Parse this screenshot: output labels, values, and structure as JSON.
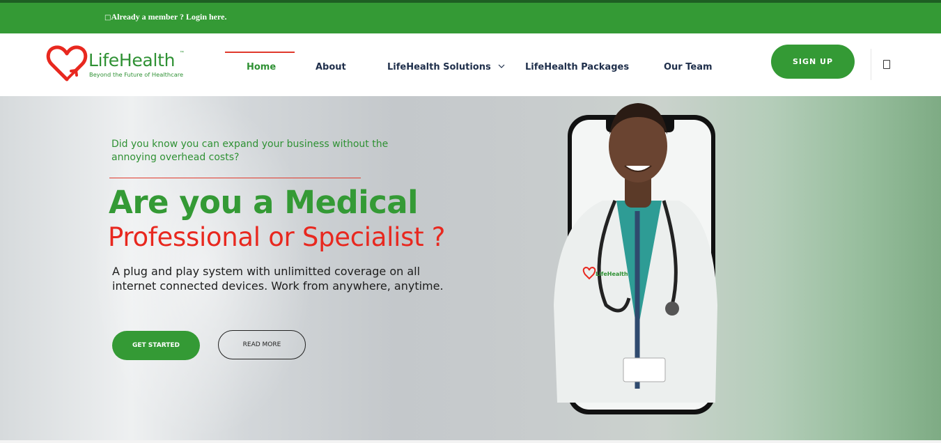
{
  "topbar": {
    "login_icon": "□",
    "login_text": "Already a member ? Login here."
  },
  "logo": {
    "name": "LifeHealth",
    "trademark": "™",
    "tagline": "Beyond the Future of Healthcare"
  },
  "nav": {
    "home": "Home",
    "about": "About",
    "solutions": "LifeHealth Solutions",
    "packages": "LifeHealth Packages",
    "team": "Our Team",
    "signup": "SIGN UP"
  },
  "hero": {
    "intro": "Did you know you can expand your business without the annoying overhead costs?",
    "title": "Are you a Medical",
    "subtitle": "Professional or Specialist ?",
    "description": "A plug and play system with unlimitted coverage on all internet connected devices. Work from anywhere, anytime.",
    "cta_primary": "GET STARTED",
    "cta_secondary": "READ MORE",
    "badge_logo_text": "LifeHealth"
  },
  "colors": {
    "brand_green": "#349a35",
    "accent_red": "#e8281f",
    "nav_text": "#1f2f4b"
  },
  "icons": [
    "heart-logo-icon",
    "chevron-down-icon",
    "cart-icon"
  ]
}
